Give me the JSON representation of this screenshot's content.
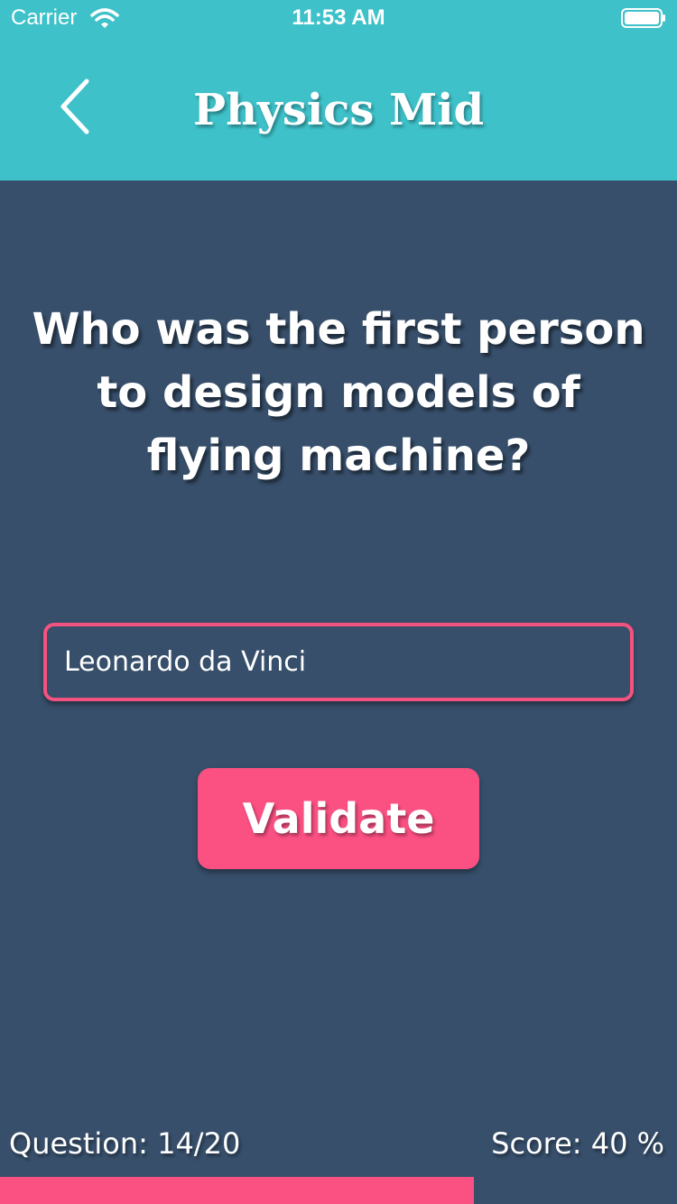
{
  "status_bar": {
    "carrier": "Carrier",
    "time": "11:53 AM",
    "wifi_icon": "wifi-icon",
    "battery_icon": "battery-icon"
  },
  "header": {
    "title": "Physics Mid",
    "back_icon": "chevron-left-icon"
  },
  "quiz": {
    "question": "Who was the first person to design models of flying machine?",
    "answer_value": "Leonardo da Vinci",
    "validate_label": "Validate"
  },
  "footer": {
    "question_counter": "Question: 14/20",
    "score": "Score: 40 %",
    "progress_fraction": 0.7
  },
  "colors": {
    "header_bg": "#3ec1c9",
    "page_bg": "#374f6b",
    "accent": "#fb5082"
  }
}
